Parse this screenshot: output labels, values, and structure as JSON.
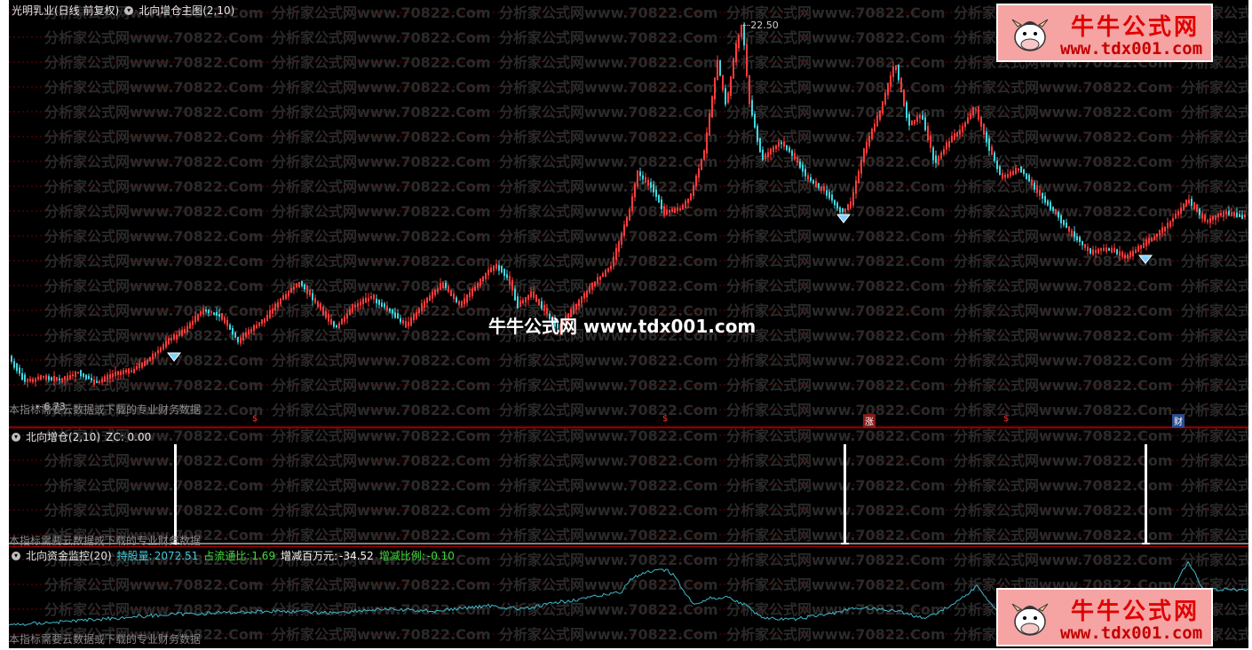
{
  "watermark_tile": "分析家公式网www.70822.Com",
  "main": {
    "stock": "光明乳业(日线 前复权)",
    "indicator": "北向增仓主图(2,10)",
    "high_label": "22.50",
    "low_label": "6.73",
    "note": "本指标需要云数据或下载的专业财务数据",
    "center_watermark": "牛牛公式网 www.tdx001.com",
    "markers": [
      {
        "text": "$",
        "kind": "s"
      },
      {
        "text": "$",
        "kind": "s"
      },
      {
        "text": "涨",
        "kind": "z"
      },
      {
        "text": "$",
        "kind": "s"
      },
      {
        "text": "财",
        "kind": "c"
      }
    ]
  },
  "mid": {
    "title": "北向增仓(2,10)",
    "zc": "ZC: 0.00",
    "note": "本指标需要云数据或下载的专业财务数据"
  },
  "bot": {
    "title": "北向资金监控(20)",
    "hold_label": "持股量:",
    "hold_value": "2072.51",
    "ratio_label": "占流通比:",
    "ratio_value": "1.69",
    "chg_label": "增减百万元:",
    "chg_value": "-34.52",
    "pct_label": "增减比例:",
    "pct_value": "-0.10",
    "note": "本指标需要云数据或下载的专业财务数据"
  },
  "badge": {
    "brand": "牛牛公式网",
    "url": "www.tdx001.com"
  },
  "colors": {
    "up": "#ff3b3b",
    "down": "#3fd6e0",
    "grid": "#7a0000",
    "curve": "#3fb8c8"
  }
}
